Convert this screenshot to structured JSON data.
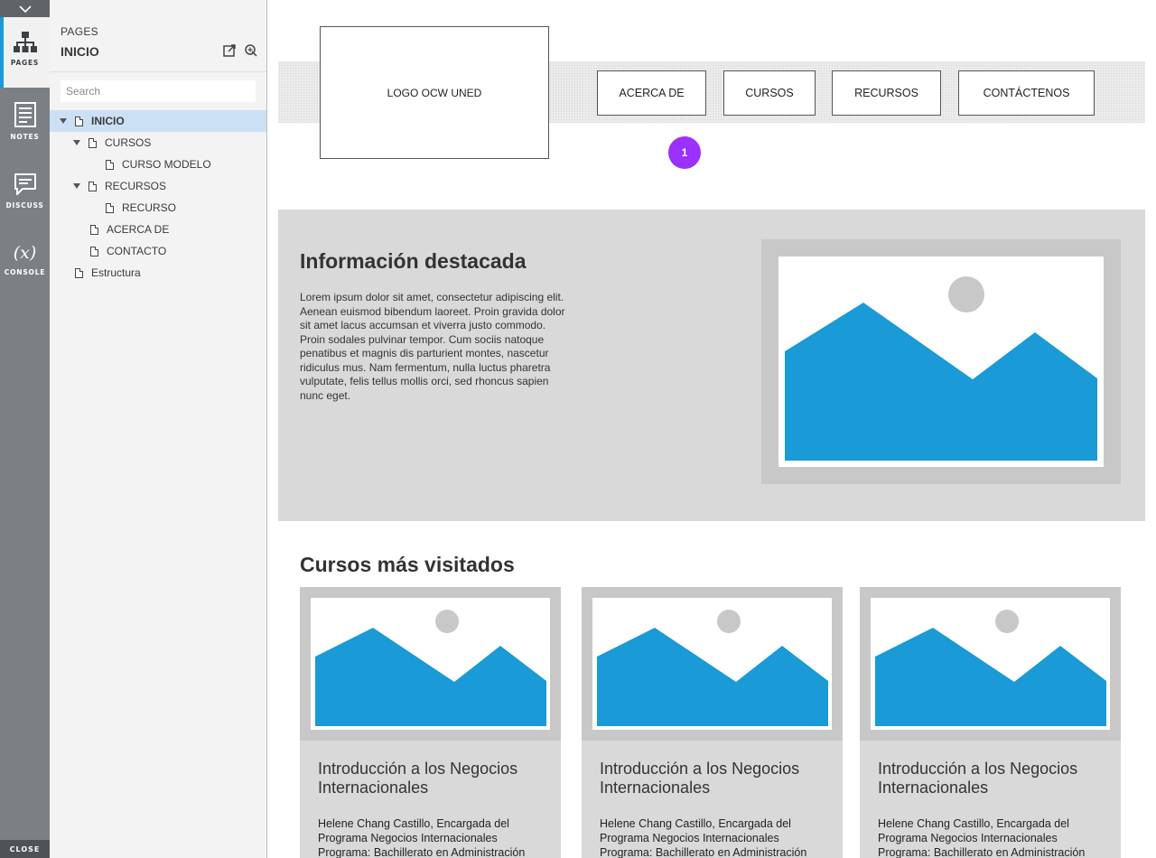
{
  "rail": {
    "items": [
      {
        "label": "PAGES",
        "icon": "sitemap-icon"
      },
      {
        "label": "NOTES",
        "icon": "notes-icon"
      },
      {
        "label": "DISCUSS",
        "icon": "discuss-icon"
      },
      {
        "label": "CONSOLE",
        "icon": "console-icon",
        "glyph": "(x)"
      }
    ],
    "close_label": "CLOSE",
    "accent": "#1a9ad6"
  },
  "panel": {
    "subtitle": "PAGES",
    "title": "INICIO",
    "search_placeholder": "Search",
    "tree": [
      {
        "label": "INICIO",
        "selected": true
      },
      {
        "label": "CURSOS"
      },
      {
        "label": "CURSO MODELO"
      },
      {
        "label": "RECURSOS"
      },
      {
        "label": "RECURSO"
      },
      {
        "label": "ACERCA DE"
      },
      {
        "label": "CONTACTO"
      },
      {
        "label": "Estructura"
      }
    ]
  },
  "page": {
    "logo": "LOGO OCW UNED",
    "nav": [
      "ACERCA DE",
      "CURSOS",
      "RECURSOS",
      "CONTÁCTENOS"
    ],
    "badge": "1",
    "badge_color": "#9b30ff",
    "image_color": "#1a9ad6",
    "hero": {
      "title": "Información destacada",
      "text": "Lorem ipsum dolor sit amet, consectetur adipiscing elit. Aenean euismod bibendum laoreet. Proin gravida dolor sit amet lacus accumsan et viverra justo commodo. Proin sodales pulvinar tempor. Cum sociis natoque penatibus et magnis dis parturient montes, nascetur ridiculus mus. Nam fermentum, nulla luctus pharetra vulputate, felis tellus mollis orci, sed rhoncus sapien nunc eget."
    },
    "courses_title": "Cursos más visitados",
    "courses": [
      {
        "title": "Introducción a los Negocios Internacionales",
        "text": "Helene Chang Castillo, Encargada del Programa Negocios Internacionales Programa: Bachillerato en Administración"
      },
      {
        "title": "Introducción a los Negocios Internacionales",
        "text": "Helene Chang Castillo, Encargada del Programa Negocios Internacionales Programa: Bachillerato en Administración"
      },
      {
        "title": "Introducción a los Negocios Internacionales",
        "text": "Helene Chang Castillo, Encargada del Programa Negocios Internacionales Programa: Bachillerato en Administración"
      }
    ]
  }
}
